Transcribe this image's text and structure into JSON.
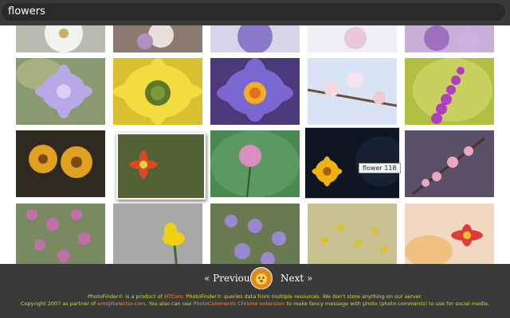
{
  "search": {
    "value": "flowers"
  },
  "tooltip": "flower 118",
  "nav": {
    "prev": "« Previous",
    "next": "Next »"
  },
  "logo_icon": "lion-face-icon",
  "footer": {
    "l1a": "PhotoFinder© is a product of ",
    "l1b": "HTCom",
    "l1c": ". PhotoFinder© queries data from multiple resources. We don't store anything on our server.",
    "l2a": "Copyright 2007 as partner of ",
    "l2b": "emojISelector.com",
    "l2c": ". You also can use ",
    "l2d": "PhotoComments Chrome extension",
    "l2e": " to make fancy message with photo (photo comments) to use for social media."
  },
  "colors": {
    "bar": "#3a3a3a",
    "footer_text": "#d8d840",
    "footer_link": "#ff8c2a"
  }
}
